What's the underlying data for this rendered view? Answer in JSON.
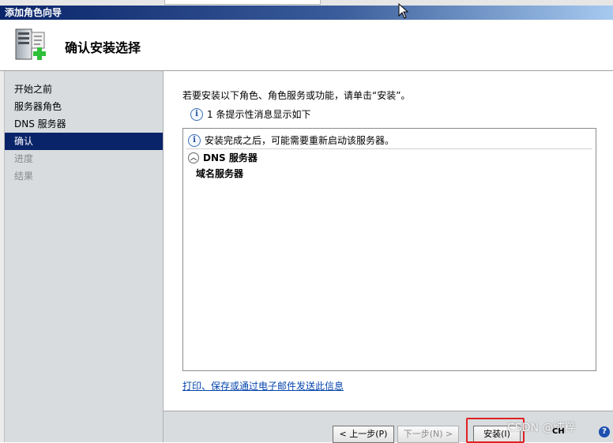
{
  "window": {
    "title": "添加角色向导"
  },
  "header": {
    "title": "确认安装选择",
    "icon": "server-add-icon"
  },
  "sidebar": {
    "items": [
      {
        "label": "开始之前",
        "state": "normal"
      },
      {
        "label": "服务器角色",
        "state": "normal"
      },
      {
        "label": "DNS 服务器",
        "state": "normal"
      },
      {
        "label": "确认",
        "state": "active"
      },
      {
        "label": "进度",
        "state": "disabled"
      },
      {
        "label": "结果",
        "state": "disabled"
      }
    ]
  },
  "main": {
    "instruction": "若要安装以下角色、角色服务或功能，请单击“安装”。",
    "info_summary": "1 条提示性消息显示如下",
    "list": {
      "message": "安装完成之后，可能需要重新启动该服务器。",
      "section_title": "DNS 服务器",
      "section_item": "域名服务器"
    },
    "print_link": "打印、保存或通过电子邮件发送此信息"
  },
  "footer": {
    "back_label": "< 上一步(P)",
    "next_label": "下一步(N) >",
    "install_label": "安装(I)",
    "tray_lang": "CH",
    "watermark": "CSDN @纯粹"
  },
  "colors": {
    "active_item": "#0a246a",
    "highlight": "#e02020",
    "link": "#0645ad"
  }
}
